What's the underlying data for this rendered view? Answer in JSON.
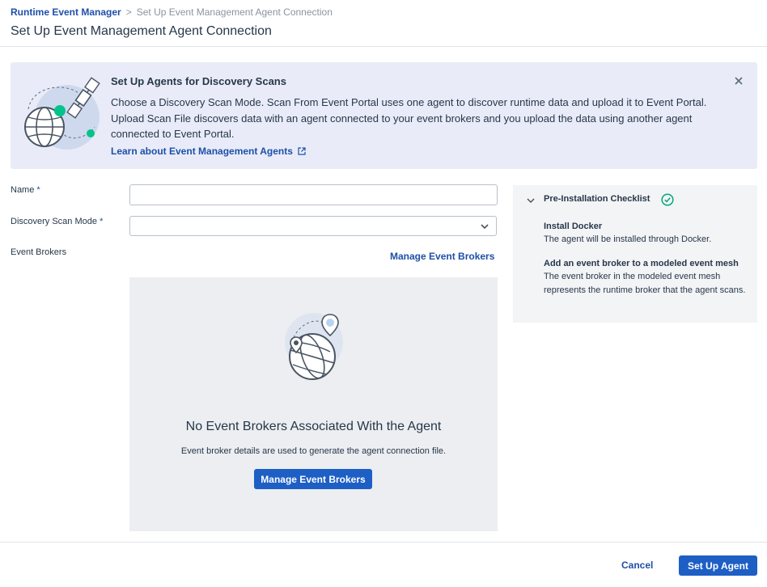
{
  "breadcrumb": {
    "parent": "Runtime Event Manager",
    "separator": ">",
    "current": "Set Up Event Management Agent Connection"
  },
  "page": {
    "title": "Set Up Event Management Agent Connection"
  },
  "banner": {
    "title": "Set Up Agents for Discovery Scans",
    "body": "Choose a Discovery Scan Mode. Scan From Event Portal uses one agent to discover runtime data and upload it to Event Portal. Upload Scan File discovers data with an agent connected to your event brokers and you upload the data using another agent connected to Event Portal.",
    "link": "Learn about Event Management Agents",
    "icons": [
      "globe-satellite-illustration",
      "external-link-icon",
      "close-icon"
    ]
  },
  "form": {
    "name_label": "Name",
    "name_value": "",
    "scan_mode_label": "Discovery Scan Mode",
    "scan_mode_value": "",
    "required_marker": "*",
    "event_brokers_label": "Event Brokers",
    "manage_link": "Manage Event Brokers"
  },
  "empty_state": {
    "title": "No Event Brokers Associated With the Agent",
    "description": "Event broker details are used to generate the agent connection file.",
    "button": "Manage Event Brokers"
  },
  "checklist": {
    "title": "Pre-Installation Checklist",
    "items": [
      {
        "title": "Install Docker",
        "description": "The agent will be installed through Docker."
      },
      {
        "title": "Add an event broker to a modeled event mesh",
        "description": "The event broker in the modeled event mesh represents the runtime broker that the agent scans."
      }
    ]
  },
  "footer": {
    "cancel": "Cancel",
    "submit": "Set Up Agent"
  },
  "colors": {
    "link": "#1d4fa8",
    "primary_button": "#1d5fc4",
    "banner_bg": "#e9ecf8",
    "success": "#00a87e"
  }
}
